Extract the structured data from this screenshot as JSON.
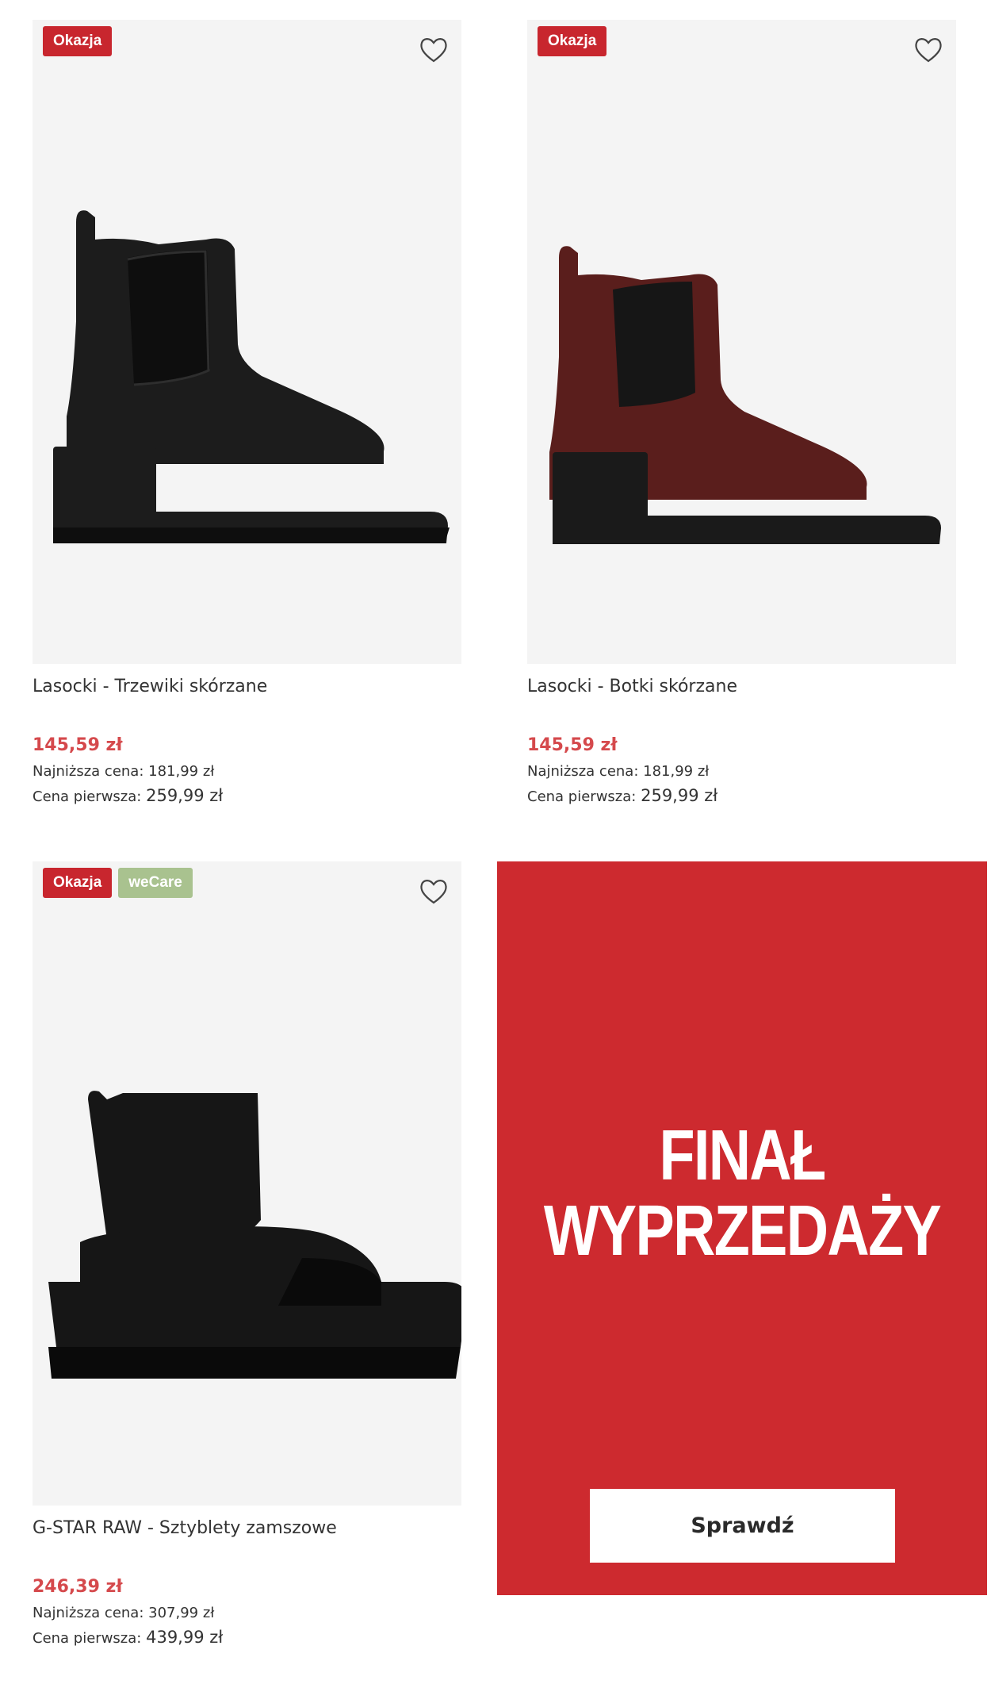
{
  "products": [
    {
      "badges": [
        "Okazja"
      ],
      "title": "Lasocki - Trzewiki skórzane",
      "price": "145,59 zł",
      "lowest_label": "Najniższa cena:",
      "lowest_value": "181,99 zł",
      "first_label": "Cena pierwsza:",
      "first_value": "259,99 zł",
      "image": "black-chelsea-boot",
      "color": "#1c1c1c"
    },
    {
      "badges": [
        "Okazja"
      ],
      "title": "Lasocki - Botki skórzane",
      "price": "145,59 zł",
      "lowest_label": "Najniższa cena:",
      "lowest_value": "181,99 zł",
      "first_label": "Cena pierwsza:",
      "first_value": "259,99 zł",
      "image": "burgundy-chelsea-boot",
      "color": "#5a1e1c"
    },
    {
      "badges": [
        "Okazja",
        "weCare"
      ],
      "title": "G-STAR RAW - Sztyblety zamszowe",
      "price": "246,39 zł",
      "lowest_label": "Najniższa cena:",
      "lowest_value": "307,99 zł",
      "first_label": "Cena pierwsza:",
      "first_value": "439,99 zł",
      "image": "black-suede-platform-boot",
      "color": "#161616"
    }
  ],
  "promo": {
    "line1": "FINAŁ",
    "line2": "WYPRZEDAŻY",
    "button": "Sprawdź",
    "background": "#cd2a2f"
  },
  "icons": {
    "favorite": "heart-outline-icon"
  }
}
